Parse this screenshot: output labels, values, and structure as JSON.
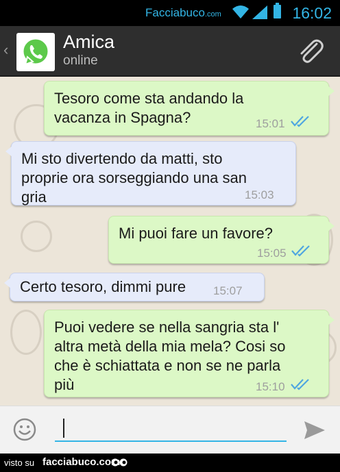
{
  "statusbar": {
    "brand": "Facciabuco",
    "brand_domain": ".com",
    "clock": "16:02"
  },
  "header": {
    "back_symbol": "‹",
    "contact_name": "Amica",
    "contact_status": "online",
    "icons": [
      "whatsapp-logo-icon",
      "paperclip-icon"
    ]
  },
  "messages": [
    {
      "direction": "out",
      "text": "Tesoro come sta andando la\nvacanza in Spagna?",
      "time": "15:01",
      "read": true
    },
    {
      "direction": "in",
      "text": "Mi sto divertendo da matti, sto\nproprie ora sorseggiando una san\ngria",
      "time": "15:03"
    },
    {
      "direction": "out",
      "text": "Mi puoi fare un favore?",
      "time": "15:05",
      "read": true
    },
    {
      "direction": "in",
      "text": "Certo tesoro, dimmi pure",
      "time": "15:07"
    },
    {
      "direction": "out",
      "text": "Puoi vedere se nella sangria sta l'\naltra metà della mia mela? Cosi so\nche  è schiattata e non se ne parla\npiù",
      "time": "15:10",
      "read": true
    }
  ],
  "inputbar": {
    "value": "",
    "icons": [
      "emoji-icon",
      "send-icon"
    ]
  },
  "footer": {
    "visto": "visto su",
    "site": "facciabuco.com"
  },
  "colors": {
    "header_bg": "#2e2e2e",
    "out_bubble": "#dcf8c6",
    "in_bubble": "#e6ebfa",
    "accent": "#33b5e5",
    "tick": "#4fa6e0"
  }
}
